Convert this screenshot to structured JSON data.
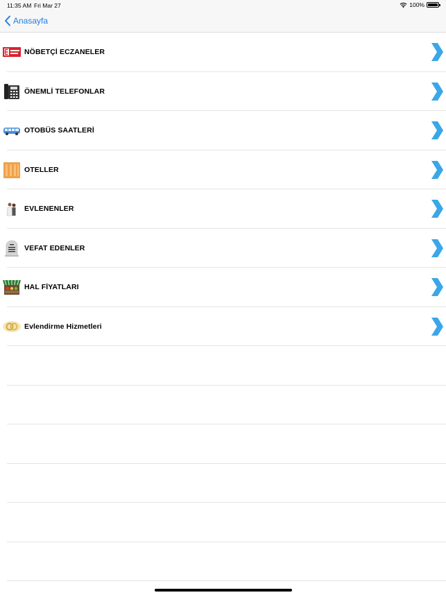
{
  "status_bar": {
    "time": "11:35 AM",
    "date": "Fri Mar 27",
    "battery": "100%"
  },
  "nav": {
    "back_label": "Anasayfa"
  },
  "menu": [
    {
      "label": "NÖBETÇİ ECZANELER",
      "icon": "pharmacy-icon"
    },
    {
      "label": "ÖNEMLİ TELEFONLAR",
      "icon": "telephone-icon"
    },
    {
      "label": "OTOBÜS SAATLERİ",
      "icon": "bus-icon"
    },
    {
      "label": "OTELLER",
      "icon": "hotel-icon"
    },
    {
      "label": "EVLENENLER",
      "icon": "wedding-couple-icon"
    },
    {
      "label": "VEFAT EDENLER",
      "icon": "gravestone-icon"
    },
    {
      "label": "HAL FİYATLARI",
      "icon": "market-stall-icon"
    },
    {
      "label": "Evlendirme Hizmetleri",
      "icon": "wedding-rings-icon"
    }
  ],
  "colors": {
    "accent": "#1f7fe6",
    "chevron": "#3ba7e8"
  }
}
